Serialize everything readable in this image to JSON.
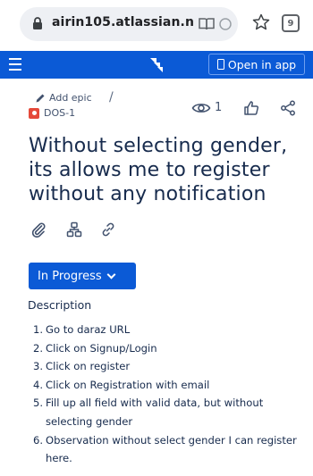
{
  "browser": {
    "url": "airin105.atlassian.n",
    "tab_count": "9"
  },
  "app_bar": {
    "open_in_app_label": "Open in app",
    "accent_color": "#0b5ad6"
  },
  "breadcrumb": {
    "add_epic_label": "Add epic",
    "separator": "/",
    "issue_key": "DOS-1"
  },
  "issue_actions": {
    "watch_count": "1"
  },
  "issue": {
    "title": "Without selecting gender, its allows me to register without any notification",
    "status": "In Progress",
    "description_label": "Description",
    "steps": [
      {
        "num": "1.",
        "text": "Go to daraz URL"
      },
      {
        "num": "2.",
        "text": "Click on Signup/Login"
      },
      {
        "num": "3.",
        "text": "Click on register"
      },
      {
        "num": "4.",
        "text": "Click on Registration with email"
      },
      {
        "num": "5.",
        "text": "Fill up all field with valid data, but without selecting gender"
      },
      {
        "num": "6.",
        "text": "Observation without select gender I can register here."
      }
    ]
  },
  "icons": [
    "lock-icon",
    "reader-mode-icon",
    "reload-icon",
    "star-icon",
    "tabs-icon",
    "menu-icon",
    "jira-logo-icon",
    "phone-icon",
    "pencil-icon",
    "bug-icon",
    "eye-icon",
    "like-icon",
    "share-icon",
    "attachment-icon",
    "child-issue-icon",
    "link-icon",
    "chevron-down-icon"
  ]
}
